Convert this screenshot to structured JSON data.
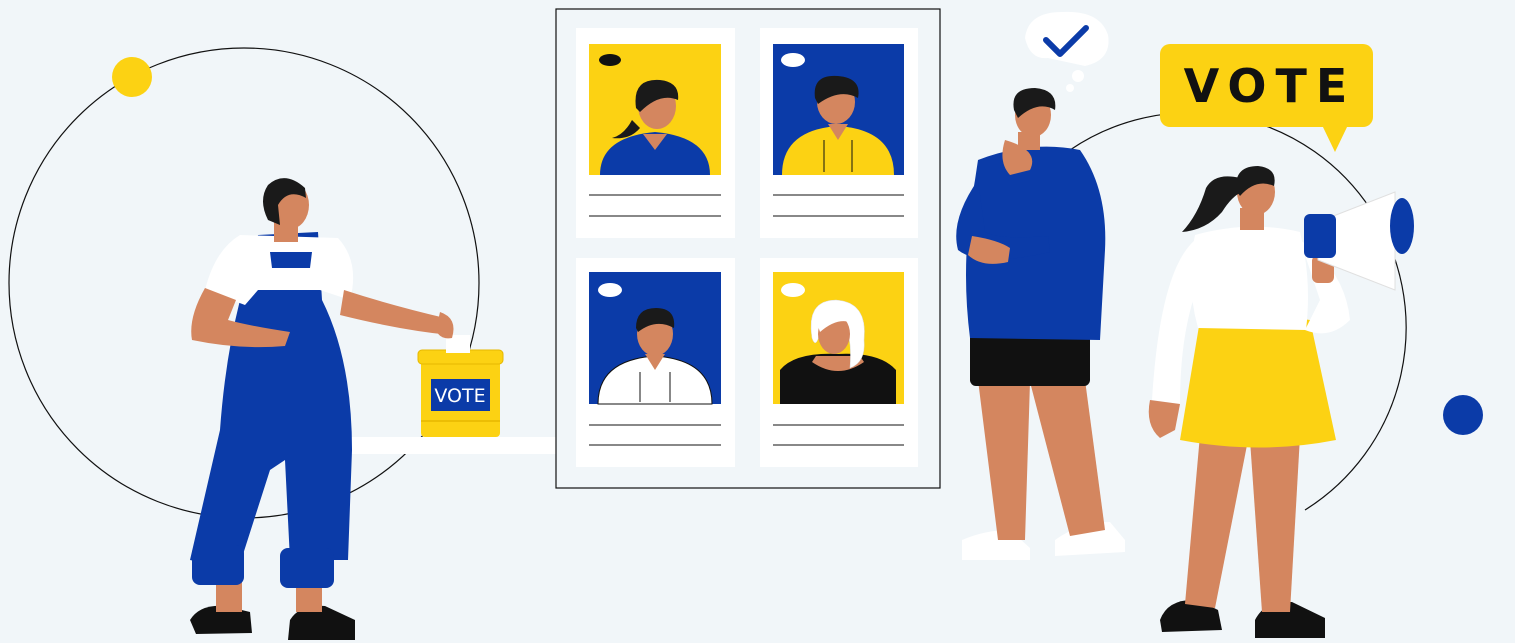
{
  "scene": {
    "ballot_box_label": "VOTE",
    "speech_bubble_text": "VOTE",
    "candidates": [
      {
        "name": "candidate-woman-yellow-bg"
      },
      {
        "name": "candidate-man-blue-bg"
      },
      {
        "name": "candidate-man-white-shirt"
      },
      {
        "name": "candidate-blonde-woman"
      }
    ],
    "colors": {
      "background": "#f1f6f9",
      "blue": "#0b3ba8",
      "yellow": "#fcd213",
      "skin": "#d4865f",
      "hair": "#1a1a1a",
      "white": "#ffffff",
      "ink": "#111111"
    }
  }
}
